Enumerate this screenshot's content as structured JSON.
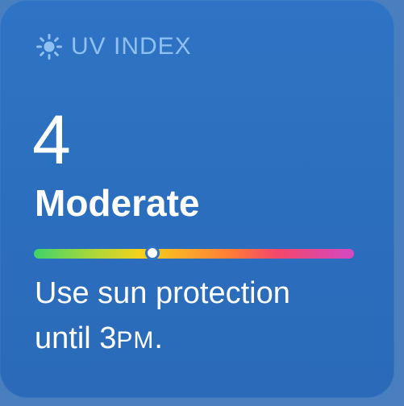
{
  "widget": {
    "header": {
      "label": "UV INDEX",
      "icon": "sun-icon",
      "color": "#8fc0f2"
    },
    "uv_value": "4",
    "uv_category": "Moderate",
    "scale": {
      "current_fraction": 0.37,
      "colors": [
        "#3fd26a",
        "#a8d83a",
        "#f3d21b",
        "#fca62b",
        "#ff7a38",
        "#f2476c",
        "#d449c2"
      ]
    },
    "advice": {
      "line1": "Use sun protection",
      "line2_prefix": "until 3",
      "line2_suffix": "PM",
      "line2_end": "."
    },
    "background": "#2f74c4"
  }
}
